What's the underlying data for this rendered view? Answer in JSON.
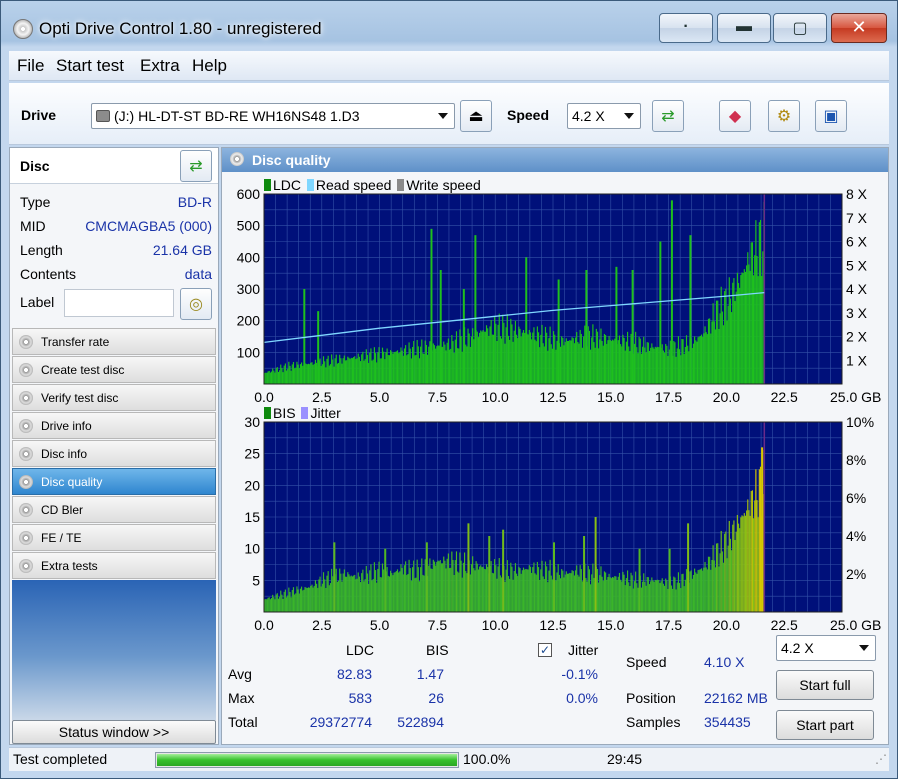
{
  "window": {
    "title": "Opti Drive Control 1.80 - unregistered"
  },
  "menu": [
    {
      "label": "File"
    },
    {
      "label": "Start test"
    },
    {
      "label": "Extra"
    },
    {
      "label": "Help"
    }
  ],
  "toolbar": {
    "drive_label": "Drive",
    "drive_value": "(J:)   HL-DT-ST BD-RE  WH16NS48 1.D3",
    "speed_label": "Speed",
    "speed_value": "4.2 X"
  },
  "disc": {
    "heading": "Disc",
    "rows": [
      {
        "key": "Type",
        "value": "BD-R"
      },
      {
        "key": "MID",
        "value": "CMCMAGBA5 (000)"
      },
      {
        "key": "Length",
        "value": "21.64 GB"
      },
      {
        "key": "Contents",
        "value": "data"
      }
    ],
    "label_key": "Label",
    "label_value": ""
  },
  "nav": [
    {
      "label": "Transfer rate",
      "active": false
    },
    {
      "label": "Create test disc",
      "active": false
    },
    {
      "label": "Verify test disc",
      "active": false
    },
    {
      "label": "Drive info",
      "active": false
    },
    {
      "label": "Disc info",
      "active": false
    },
    {
      "label": "Disc quality",
      "active": true
    },
    {
      "label": "CD Bler",
      "active": false
    },
    {
      "label": "FE / TE",
      "active": false
    },
    {
      "label": "Extra tests",
      "active": false
    }
  ],
  "status_window_button": "Status window >>",
  "panel_title": "Disc quality",
  "chart_data": [
    {
      "type": "area",
      "legend": [
        "LDC",
        "Read speed",
        "Write speed"
      ],
      "x_ticks": [
        "0.0",
        "2.5",
        "5.0",
        "7.5",
        "10.0",
        "12.5",
        "15.0",
        "17.5",
        "20.0",
        "22.5",
        "25.0 GB"
      ],
      "xlim": [
        0,
        25
      ],
      "y_ticks": [
        "100",
        "200",
        "300",
        "400",
        "500",
        "600"
      ],
      "ylim": [
        0,
        600
      ],
      "y2_ticks": [
        "1 X",
        "2 X",
        "3 X",
        "4 X",
        "5 X",
        "6 X",
        "7 X",
        "8 X"
      ],
      "y2lim": [
        0,
        8
      ],
      "data_end": 21.64,
      "series": [
        {
          "name": "LDC",
          "x": [
            0,
            0.5,
            1,
            1.5,
            2,
            2.5,
            3,
            3.5,
            4,
            4.5,
            5,
            5.5,
            6,
            6.5,
            7,
            7.5,
            8,
            8.5,
            9,
            9.5,
            10,
            10.5,
            11,
            11.5,
            12,
            12.5,
            13,
            13.5,
            14,
            14.5,
            15,
            15.5,
            16,
            16.5,
            17,
            17.5,
            18,
            18.5,
            19,
            19.5,
            20,
            20.5,
            21,
            21.5
          ],
          "values": [
            35,
            45,
            55,
            60,
            65,
            70,
            75,
            80,
            85,
            90,
            95,
            100,
            105,
            110,
            115,
            120,
            125,
            140,
            150,
            170,
            180,
            175,
            165,
            160,
            150,
            140,
            135,
            145,
            150,
            145,
            140,
            135,
            130,
            120,
            115,
            110,
            120,
            130,
            160,
            220,
            260,
            320,
            400,
            450
          ]
        },
        {
          "name": "LDC peaks",
          "x": [
            1.7,
            2.3,
            7.2,
            7.6,
            8.6,
            9.1,
            11.3,
            12.7,
            13.9,
            15.2,
            15.9,
            17.1,
            17.6,
            18.4
          ],
          "values": [
            300,
            230,
            490,
            360,
            300,
            470,
            400,
            330,
            360,
            370,
            360,
            450,
            580,
            470
          ]
        },
        {
          "name": "Read speed",
          "x": [
            0,
            2.5,
            5,
            7.5,
            10,
            12.5,
            15,
            17.5,
            20,
            21.64
          ],
          "values": [
            1.75,
            2.05,
            2.35,
            2.6,
            2.85,
            3.1,
            3.3,
            3.5,
            3.7,
            3.85
          ]
        }
      ]
    },
    {
      "type": "area",
      "legend": [
        "BIS",
        "Jitter"
      ],
      "x_ticks": [
        "0.0",
        "2.5",
        "5.0",
        "7.5",
        "10.0",
        "12.5",
        "15.0",
        "17.5",
        "20.0",
        "22.5",
        "25.0 GB"
      ],
      "xlim": [
        0,
        25
      ],
      "y_ticks": [
        "5",
        "10",
        "15",
        "20",
        "25",
        "30"
      ],
      "ylim": [
        0,
        30
      ],
      "y2_ticks": [
        "2%",
        "4%",
        "6%",
        "8%",
        "10%"
      ],
      "y2lim": [
        0,
        10
      ],
      "data_end": 21.64,
      "series": [
        {
          "name": "BIS",
          "x": [
            0,
            0.5,
            1,
            1.5,
            2,
            2.5,
            3,
            3.5,
            4,
            4.5,
            5,
            5.5,
            6,
            6.5,
            7,
            7.5,
            8,
            8.5,
            9,
            9.5,
            10,
            10.5,
            11,
            11.5,
            12,
            12.5,
            13,
            13.5,
            14,
            14.5,
            15,
            15.5,
            16,
            16.5,
            17,
            17.5,
            18,
            18.5,
            19,
            19.5,
            20,
            20.5,
            21,
            21.5
          ],
          "values": [
            2,
            2.5,
            3,
            3.5,
            4,
            5,
            5.5,
            6,
            5.5,
            6,
            6.5,
            6,
            7,
            6.5,
            7,
            8,
            8,
            7.5,
            7.5,
            7,
            7,
            6.5,
            6.5,
            7,
            6.5,
            6.5,
            6,
            6.5,
            6,
            6,
            5.5,
            5.5,
            5,
            5,
            5,
            4.5,
            5,
            6,
            7,
            9,
            11,
            14,
            17,
            20
          ]
        },
        {
          "name": "BIS peaks",
          "x": [
            3,
            5.2,
            7,
            8.8,
            9.7,
            10.3,
            12.5,
            13.8,
            14.3,
            16.2,
            17.5,
            18.3,
            21.5
          ],
          "values": [
            11,
            10,
            11,
            14,
            12,
            13,
            11,
            12,
            15,
            10,
            10,
            14,
            26
          ]
        }
      ]
    }
  ],
  "stats": {
    "col_ldc": "LDC",
    "col_bis": "BIS",
    "jitter_label": "Jitter",
    "jitter_checked": true,
    "rows": [
      {
        "label": "Avg",
        "ldc": "82.83",
        "bis": "1.47",
        "jitter": "-0.1%"
      },
      {
        "label": "Max",
        "ldc": "583",
        "bis": "26",
        "jitter": "0.0%"
      },
      {
        "label": "Total",
        "ldc": "29372774",
        "bis": "522894",
        "jitter": ""
      }
    ],
    "speed_label": "Speed",
    "speed_value": "4.10 X",
    "position_label": "Position",
    "position_value": "22162 MB",
    "samples_label": "Samples",
    "samples_value": "354435",
    "speed_select": "4.2 X",
    "start_full": "Start full",
    "start_part": "Start part"
  },
  "statusbar": {
    "text": "Test completed",
    "progress": 100,
    "progress_text": "100.0%",
    "time": "29:45"
  },
  "colors": {
    "chart_bg": "#00107a",
    "grid": "#3452a8",
    "ldc": "#1ec01e",
    "read_speed": "#7fd7ff",
    "bis_low": "#3ab52a",
    "bis_high": "#d8c800"
  }
}
